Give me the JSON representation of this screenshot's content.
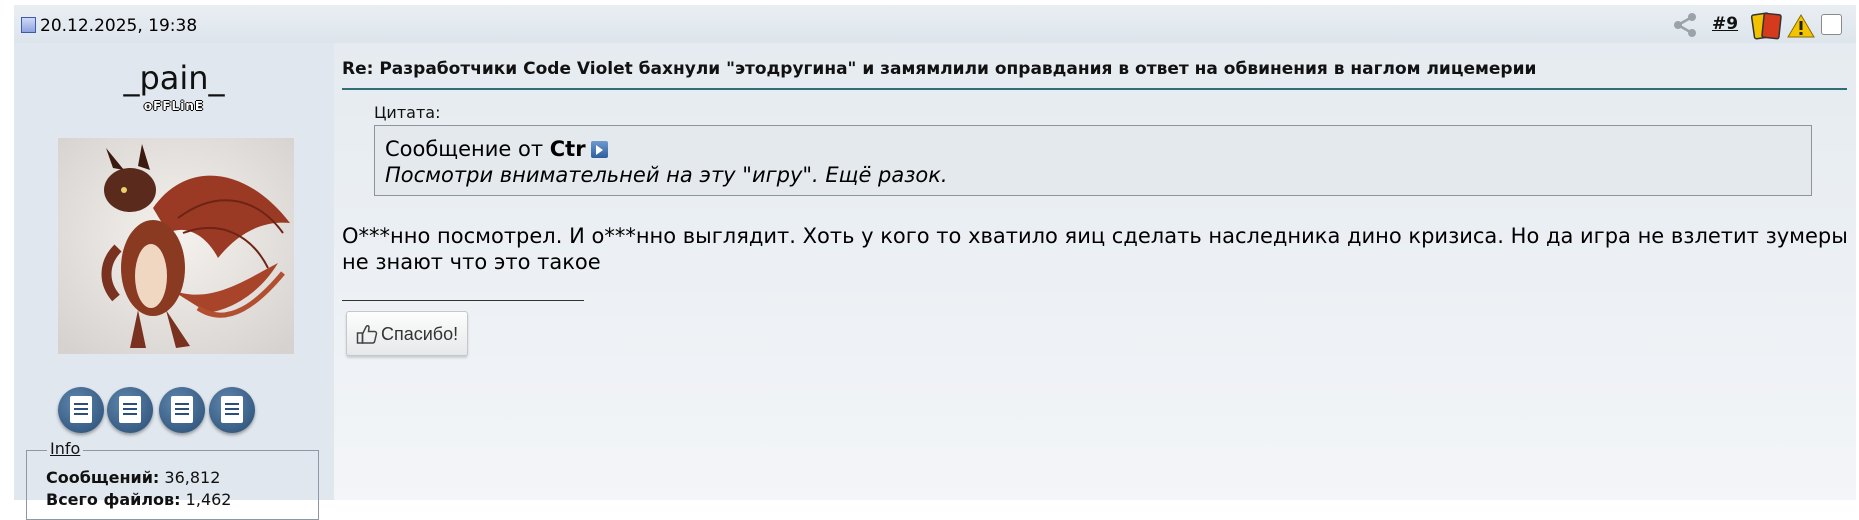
{
  "header": {
    "date": "20.12.2025, 19:38",
    "post_number": "#9",
    "icons": [
      "document-icon",
      "share-icon",
      "cards-icon",
      "warning-icon"
    ]
  },
  "user": {
    "name": "_pain_",
    "status": "oFFLinE",
    "action_icons": [
      "edit-profile-icon",
      "private-message-icon",
      "quote-icon",
      "posts-icon"
    ],
    "info": {
      "legend": "Info",
      "posts_label": "Сообщений:",
      "posts_value": "36,812",
      "files_label": "Всего файлов:",
      "files_value": "1,462"
    }
  },
  "post": {
    "title": "Re: Разработчики Code Violet бахнули \"этодругина\" и замямлили оправдания в ответ на обвинения в наглом лицемерии",
    "quote": {
      "label": "Цитата:",
      "prefix": "Сообщение от",
      "author": "Ctr",
      "text": "Посмотри внимательней на эту \"игру\". Ещё разок."
    },
    "body": "О***нно посмотрел. И о***нно выглядит. Хоть у кого то хватило яиц сделать наследника дино кризиса. Но да игра не взлетит зумеры не знают что это такое",
    "thanks_label": "Спасибо!"
  },
  "colors": {
    "title_rule": "#2f6e72",
    "background": "#e6ecf1",
    "action_icon": "#2b4f78"
  }
}
